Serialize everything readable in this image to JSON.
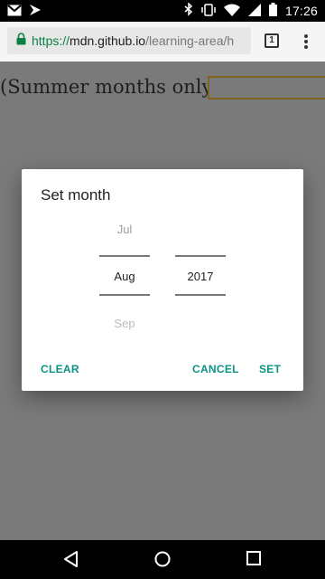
{
  "status_bar": {
    "time": "17:26",
    "icons": [
      "mail-icon",
      "notification-icon",
      "bluetooth-icon",
      "vibrate-icon",
      "wifi-icon",
      "signal-icon",
      "battery-icon"
    ]
  },
  "browser": {
    "url_scheme": "https://",
    "url_host": "mdn.github.io",
    "url_path": "/learning-area/h",
    "tab_count": "1"
  },
  "page": {
    "summer_label": "(Summer months only.)"
  },
  "dialog": {
    "title": "Set month",
    "month_prev": "Jul",
    "month_current": "Aug",
    "month_next": "Sep",
    "year_current": "2017",
    "clear_label": "CLEAR",
    "cancel_label": "CANCEL",
    "set_label": "SET"
  },
  "colors": {
    "accent": "#0a9383",
    "scrim": "#7a7a7a",
    "secure_green": "#0a8043"
  }
}
